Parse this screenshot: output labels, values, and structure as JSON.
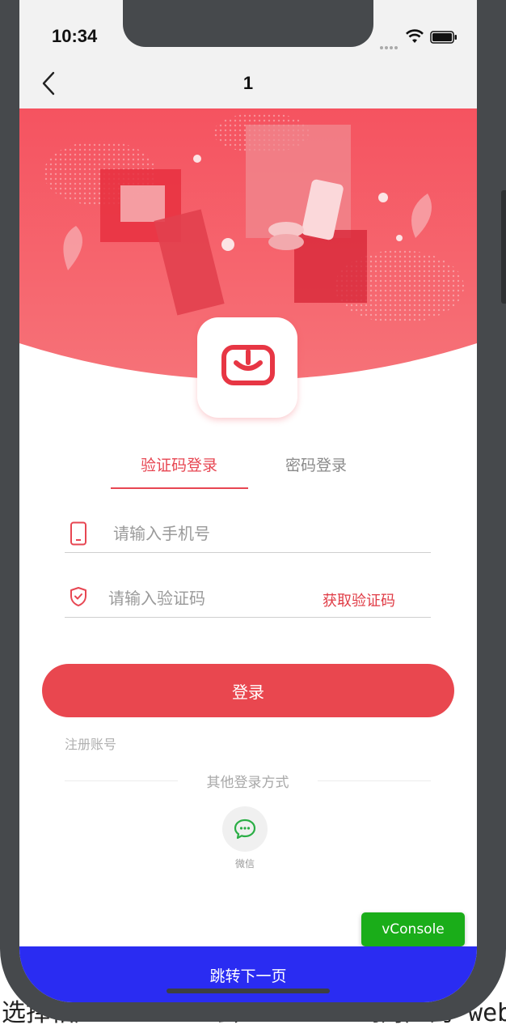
{
  "status_bar": {
    "time": "10:34"
  },
  "nav": {
    "title": "1"
  },
  "tabs": [
    {
      "label": "验证码登录",
      "active": true
    },
    {
      "label": "密码登录",
      "active": false
    }
  ],
  "form": {
    "phone_placeholder": "请输入手机号",
    "code_placeholder": "请输入验证码",
    "get_code_label": "获取验证码"
  },
  "login_button": {
    "label": "登录"
  },
  "register_link": {
    "label": "注册账号"
  },
  "other_login": {
    "divider_text": "其他登录方式",
    "methods": [
      {
        "label": "微信",
        "icon": "wechat-icon"
      }
    ]
  },
  "vconsole": {
    "label": "vConsole"
  },
  "next_page_bar": {
    "label": "跳转下一页"
  },
  "background_caption": {
    "text": "选择相应 device 会 attach 到对应的 web 页"
  },
  "colors": {
    "accent": "#e74652",
    "hero": "#f25a60",
    "next_bar": "#2a2cf2",
    "vconsole": "#1aad19"
  }
}
